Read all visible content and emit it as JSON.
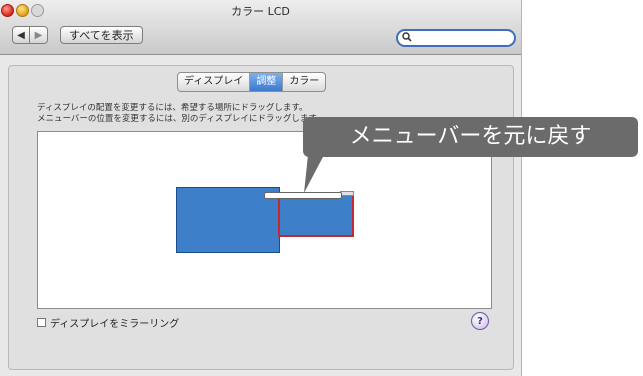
{
  "window": {
    "title": "カラー LCD",
    "back_glyph": "◀",
    "forward_glyph": "▶",
    "show_all_label": "すべてを表示",
    "search_icon": "search-icon",
    "search_glyph": "🔍",
    "search_placeholder": ""
  },
  "tabs": [
    {
      "label": "ディスプレイ",
      "active": false
    },
    {
      "label": "調整",
      "active": true
    },
    {
      "label": "カラー",
      "active": false
    }
  ],
  "instructions": {
    "line1": "ディスプレイの配置を変更するには、希望する場所にドラッグします。",
    "line2": "メニューバーの位置を変更するには、別のディスプレイにドラッグします。"
  },
  "mirror": {
    "label": "ディスプレイをミラーリング",
    "checked": false
  },
  "help_glyph": "?",
  "callout": {
    "text": "メニューバーを元に戻す"
  },
  "colors": {
    "display_fill": "#3d7fc8",
    "selected_border": "#c8282d",
    "active_tab": "#3b78cf",
    "callout_bg": "#6b6b6b"
  }
}
